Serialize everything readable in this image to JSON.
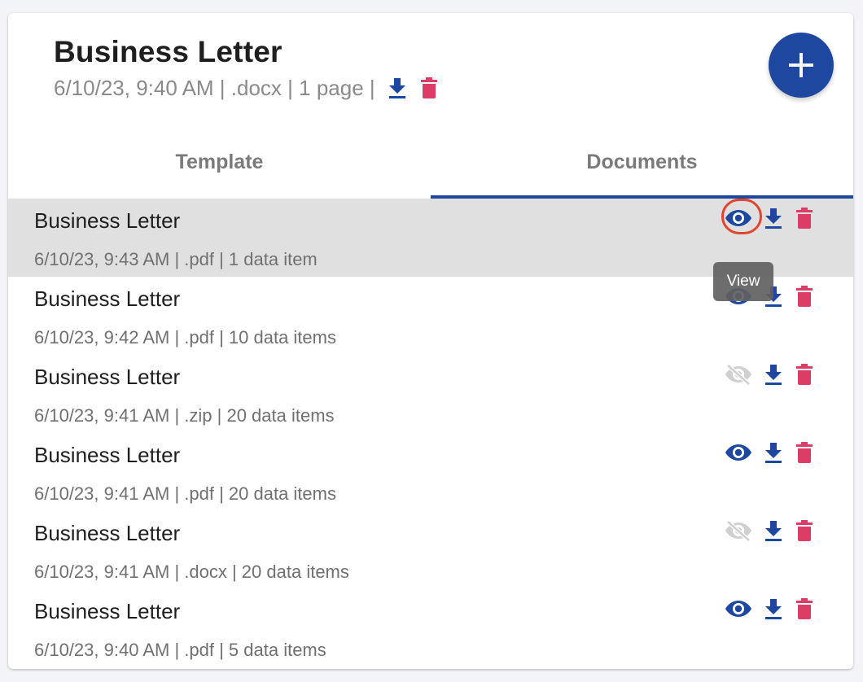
{
  "template": {
    "title": "Business Letter",
    "meta": "6/10/23, 9:40 AM | .docx | 1 page |"
  },
  "fab": {
    "icon": "plus-icon"
  },
  "tabs": [
    {
      "label": "Template",
      "active": false
    },
    {
      "label": "Documents",
      "active": true
    }
  ],
  "tooltip": "View",
  "documents": [
    {
      "title": "Business Letter",
      "meta": "6/10/23, 9:43 AM | .pdf | 1 data item",
      "viewable": true,
      "hovered": true
    },
    {
      "title": "Business Letter",
      "meta": "6/10/23, 9:42 AM | .pdf | 10 data items",
      "viewable": true,
      "hovered": false
    },
    {
      "title": "Business Letter",
      "meta": "6/10/23, 9:41 AM | .zip | 20 data items",
      "viewable": false,
      "hovered": false
    },
    {
      "title": "Business Letter",
      "meta": "6/10/23, 9:41 AM | .pdf | 20 data items",
      "viewable": true,
      "hovered": false
    },
    {
      "title": "Business Letter",
      "meta": "6/10/23, 9:41 AM | .docx | 20 data items",
      "viewable": false,
      "hovered": false
    },
    {
      "title": "Business Letter",
      "meta": "6/10/23, 9:40 AM | .pdf | 5 data items",
      "viewable": true,
      "hovered": false
    }
  ],
  "colors": {
    "primary": "#1e47a0",
    "danger": "#dc3d66",
    "disabled": "#d0d0d0",
    "highlight_ring": "#e0452f"
  }
}
